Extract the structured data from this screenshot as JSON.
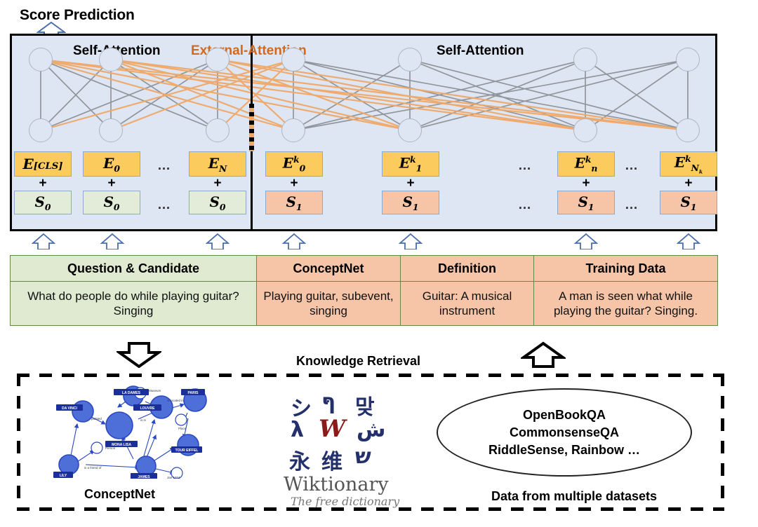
{
  "title": "Score Prediction",
  "encoder": {
    "left_attention_label": "Self-Attention",
    "external_attention_label": "External-Attention",
    "right_attention_label": "Self-Attention",
    "plus": "+",
    "ellipsis": "…",
    "left_tokens": [
      {
        "e_base": "E",
        "e_sub": "[CLS]",
        "e_sup": "",
        "s_base": "S",
        "s_sub": "0"
      },
      {
        "e_base": "E",
        "e_sub": "0",
        "e_sup": "",
        "s_base": "S",
        "s_sub": "0"
      },
      {
        "e_base": "E",
        "e_sub": "N",
        "e_sup": "",
        "s_base": "S",
        "s_sub": "0"
      }
    ],
    "right_tokens": [
      {
        "e_base": "E",
        "e_sub": "0",
        "e_sup": "k",
        "s_base": "S",
        "s_sub": "1"
      },
      {
        "e_base": "E",
        "e_sub": "1",
        "e_sup": "k",
        "s_base": "S",
        "s_sub": "1"
      },
      {
        "e_base": "E",
        "e_sub": "n",
        "e_sup": "k",
        "s_base": "S",
        "s_sub": "1"
      },
      {
        "e_base": "E",
        "e_sub": "Nk",
        "e_sup": "k",
        "s_base": "S",
        "s_sub": "1"
      }
    ]
  },
  "input_table": {
    "headers": [
      "Question & Candidate",
      "ConceptNet",
      "Definition",
      "Training Data"
    ],
    "cells": [
      "What do people do while playing guitar? Singing",
      "Playing guitar, subevent, singing",
      "Guitar: A musical instrument",
      "A man is seen what while playing the guitar? Singing."
    ]
  },
  "knowledge_retrieval": {
    "label": "Knowledge Retrieval",
    "conceptnet_caption": "ConceptNet",
    "conceptnet_nodes": [
      "DA VINCI",
      "MONA LISA",
      "LOUVRE",
      "PARIS",
      "TOUR EIFFEL",
      "LILY",
      "JAMES",
      "Museum",
      "Place",
      "Person",
      "Jan 1984",
      "LA DAMES A L'HERMINE"
    ],
    "wiktionary_name": "Wiktionary",
    "wiktionary_tagline": "The free dictionary",
    "wiktionary_glyphs": [
      "シ",
      "ףּ",
      "맞",
      "λ",
      "W",
      "ش",
      "永",
      "维",
      "ש"
    ],
    "datasets": [
      "OpenBookQA",
      "CommonsenseQA",
      "RiddleSense, Rainbow …"
    ],
    "datasets_caption": "Data from multiple datasets"
  },
  "colors": {
    "panel_bg": "#dde6f2",
    "embedding": "#fbcb5d",
    "segment_zero": "#e2ecd9",
    "segment_one": "#f6c5a8",
    "external_attention": "#d2691e",
    "self_attention_edge": "#8c9297",
    "external_attention_edge": "#f0a868"
  }
}
